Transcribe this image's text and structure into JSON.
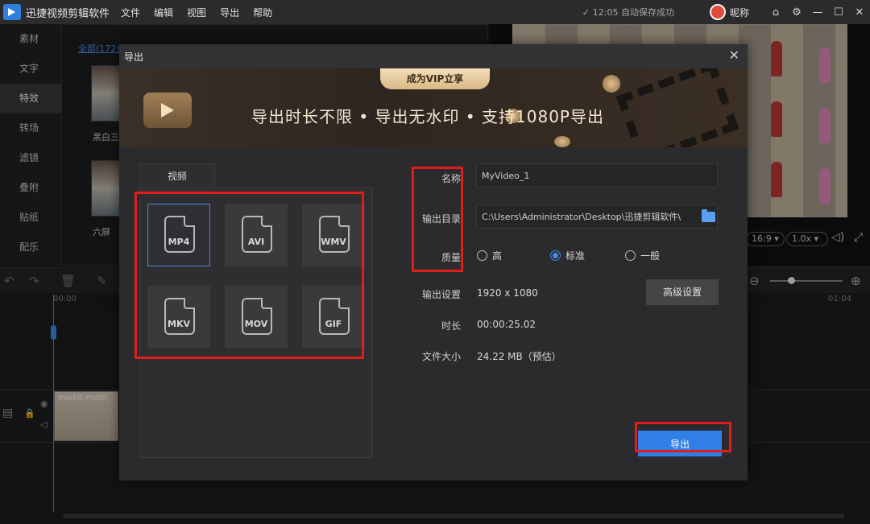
{
  "app": {
    "title": "迅捷视频剪辑软件",
    "menu": [
      "文件",
      "编辑",
      "视图",
      "导出",
      "帮助"
    ],
    "autosave": "12:05 自动保存成功",
    "nickname": "昵称"
  },
  "leftnav": {
    "items": [
      "素材",
      "文字",
      "特效",
      "转场",
      "滤镜",
      "叠附",
      "贴纸",
      "配乐"
    ],
    "active_index": 2
  },
  "media": {
    "count_label": "全部(172)",
    "thumb_labels": [
      "黑白三",
      "六屏"
    ]
  },
  "preview_controls": {
    "ratio": "16:9",
    "speed": "1.0x"
  },
  "timeline": {
    "start_time": "00:00",
    "end_time": "01:04",
    "clip_label": "mixkit-moth"
  },
  "dialog": {
    "title": "导出",
    "banner": {
      "tag": "成为VIP立享",
      "text": "导出时长不限 • 导出无水印 • 支持1080P导出"
    },
    "tab": "视频",
    "formats": [
      "MP4",
      "AVI",
      "WMV",
      "MKV",
      "MOV",
      "GIF"
    ],
    "selected_format": "MP4",
    "fields": {
      "name_label": "名称",
      "name_value": "MyVideo_1",
      "dir_label": "输出目录",
      "dir_value": "C:\\Users\\Administrator\\Desktop\\迅捷剪辑软件\\",
      "quality_label": "质量",
      "quality_options": [
        "高",
        "标准",
        "一般"
      ],
      "quality_selected": "标准",
      "output_label": "输出设置",
      "output_value": "1920 x 1080",
      "advanced_button": "高级设置",
      "duration_label": "时长",
      "duration_value": "00:00:25.02",
      "size_label": "文件大小",
      "size_value": "24.22 MB（预估）"
    },
    "export_button": "导出"
  },
  "colors": {
    "accent": "#2f7fe6",
    "highlight_box": "#e21b1b",
    "vip_gold": "#d9b886"
  }
}
